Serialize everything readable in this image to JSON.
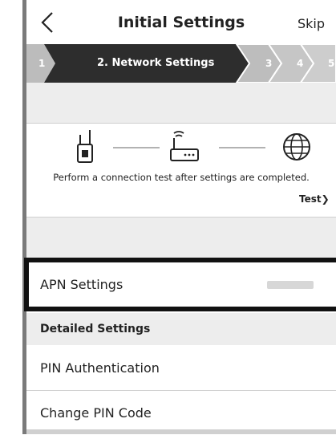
{
  "header": {
    "back_icon": "chevron-left-icon",
    "title": "Initial Settings",
    "skip_label": "Skip"
  },
  "steps": {
    "items": [
      "1",
      "2. Network Settings",
      "3",
      "4",
      "5"
    ],
    "current_index": 1
  },
  "connection": {
    "icons": [
      "router-device-icon",
      "wifi-router-icon",
      "globe-icon"
    ],
    "message": "Perform a connection test after settings are completed.",
    "test_label": "Test"
  },
  "apn": {
    "label": "APN Settings"
  },
  "detailed": {
    "heading": "Detailed Settings",
    "items": [
      {
        "label": "PIN Authentication"
      },
      {
        "label": "Change PIN Code"
      }
    ]
  },
  "colors": {
    "step_active": "#2d2d2d",
    "step_inactive": "#cfcfcf",
    "section_bg": "#ededed",
    "highlight": "#111111"
  }
}
